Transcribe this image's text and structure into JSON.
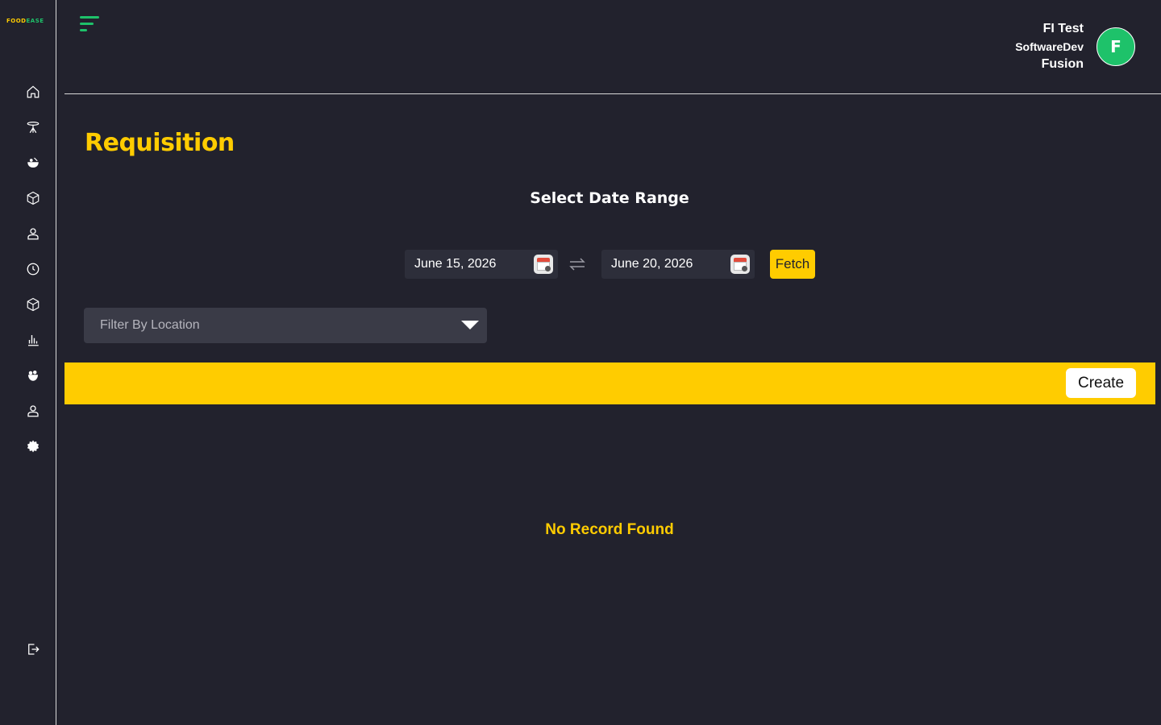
{
  "brand": {
    "logo_part1": "FOOD",
    "logo_part2": "EASE"
  },
  "user": {
    "name_line1": "FI Test",
    "name_line2": "SoftwareDev",
    "name_line3": "Fusion",
    "avatar_initial": "F"
  },
  "page": {
    "title": "Requisition",
    "date_range_heading": "Select Date Range"
  },
  "date_range": {
    "start": "June 15, 2026",
    "end": "June 20, 2026",
    "fetch_label": "Fetch"
  },
  "filter": {
    "location_placeholder": "Filter By Location"
  },
  "actions": {
    "create_label": "Create"
  },
  "results": {
    "empty_message": "No Record Found"
  },
  "colors": {
    "accent": "#ffcc00",
    "brand_green": "#1ec26a",
    "background": "#22222d"
  },
  "sidebar": {
    "icons": [
      "home-icon",
      "dining-table-icon",
      "food-bowl-icon",
      "box-icon",
      "user-icon",
      "clock-icon",
      "package-icon",
      "bar-chart-icon",
      "apple-icon",
      "staff-icon",
      "settings-icon",
      "logout-icon"
    ]
  }
}
